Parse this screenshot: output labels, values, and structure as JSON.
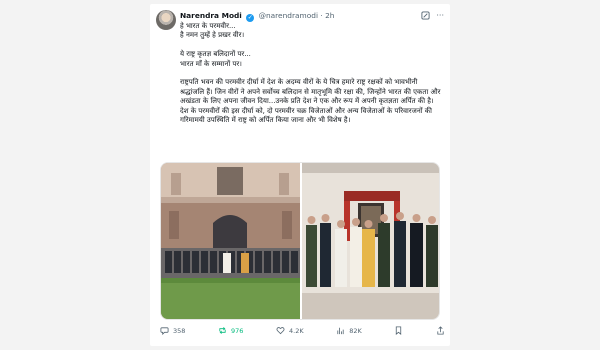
{
  "tweet": {
    "author_name": "Narendra Modi",
    "handle": "@narendramodi",
    "separator": "·",
    "time": "2h",
    "paragraphs": [
      "हे भारत के परमवीर...\nहै नमन तुम्हें हे प्रखर वीर।",
      "ये राष्ट्र कृतज्ञ बलिदानों पर...\nभारत माँ के सम्मानों पर।",
      "राष्ट्रपति भवन की परमवीर दीर्घा में देश के अदम्य वीरों के ये चित्र हमारे राष्ट्र रक्षकों को भावभीनी श्रद्धांजलि हैं। जिन वीरों ने अपने सर्वोच्च बलिदान से मातृभूमि की रक्षा की, जिन्होंने भारत की एकता और अखंडता के लिए अपना जीवन दिया...उनके प्रति देश ने एक और रूप में अपनी कृतज्ञता अर्पित की है। देश के परमवीरों की इस दीर्घा को, दो परमवीर चक्र विजेताओं और अन्य विजेताओं के परिवारजनों की गरिमामयी उपस्थिति में राष्ट्र को अर्पित किया जाना और भी विशेष है।"
    ]
  },
  "metrics": {
    "replies": "358",
    "reposts": "976",
    "likes": "4.2K",
    "views": "82K"
  },
  "icons": {
    "verified": "verified-badge-icon",
    "top": [
      "grok-icon",
      "more-icon"
    ],
    "actions": [
      "reply-icon",
      "repost-icon",
      "like-icon",
      "views-icon",
      "bookmark-icon",
      "share-icon"
    ]
  },
  "colors": {
    "verified": "#1d9bf0",
    "repost_active": "#00ba7c",
    "muted": "#536471"
  }
}
